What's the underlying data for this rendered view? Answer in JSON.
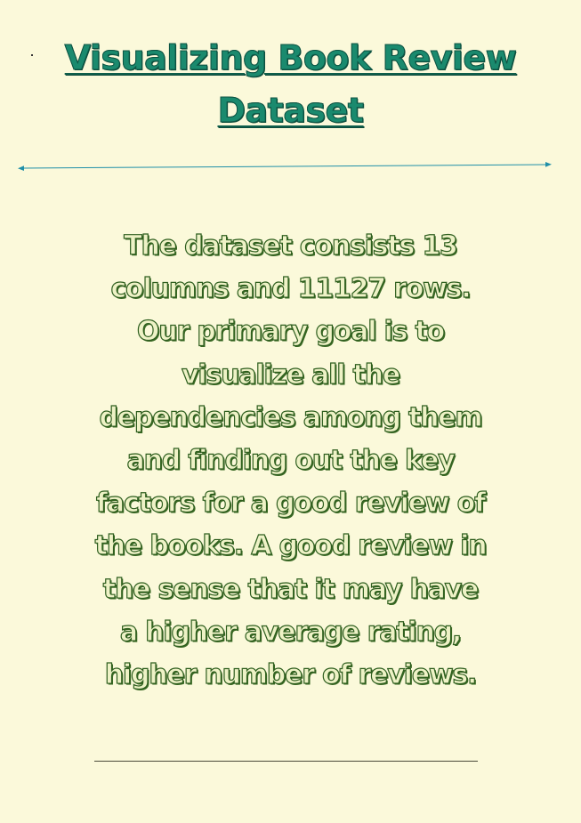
{
  "document": {
    "title": "Visualizing Book Review Dataset",
    "body": "The dataset consists 13\ncolumns and 11127 rows.\nOur primary goal is to\nvisualize all the\ndependencies among them\nand finding out the key\nfactors for a good review of\nthe books. A good review in\nthe sense that it may have\na higher average rating,\nhigher number of reviews."
  },
  "colors": {
    "background": "#fbf9da",
    "title": "#1a8a6e",
    "arrow": "#1f8fa8",
    "body_fill": "#eef2c6",
    "body_outline": "#2e5e1e"
  }
}
